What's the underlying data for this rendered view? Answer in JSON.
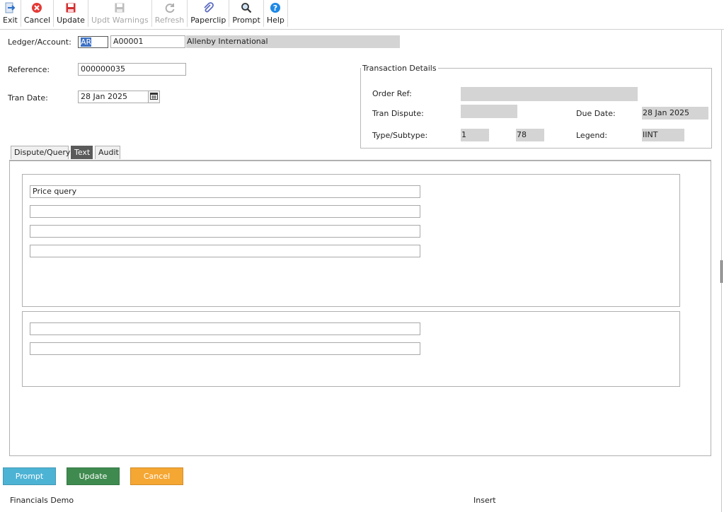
{
  "toolbar": {
    "exit": "Exit",
    "cancel": "Cancel",
    "update": "Update",
    "updt_warnings": "Updt Warnings",
    "refresh": "Refresh",
    "paperclip": "Paperclip",
    "prompt": "Prompt",
    "help": "Help"
  },
  "header": {
    "ledger_label": "Ledger/Account:",
    "ledger_value": "AR",
    "account_value": "A00001",
    "account_name": "Allenby International",
    "reference_label": "Reference:",
    "reference_value": "000000035",
    "tran_date_label": "Tran Date:",
    "tran_date_value": "28 Jan 2025"
  },
  "transaction_details": {
    "title": "Transaction Details",
    "order_ref_label": "Order Ref:",
    "order_ref_value": "",
    "tran_dispute_label": "Tran Dispute:",
    "tran_dispute_value": "",
    "due_date_label": "Due Date:",
    "due_date_value": "28 Jan 2025",
    "type_label": "Type/Subtype:",
    "type_value": "1",
    "subtype_value": "78",
    "legend_label": "Legend:",
    "legend_value": "IINT"
  },
  "tabs": [
    "Dispute/Query",
    "Text",
    "Audit"
  ],
  "active_tab": "Text",
  "text_lines_group1": [
    "Price query",
    "",
    "",
    ""
  ],
  "text_lines_group2": [
    "",
    ""
  ],
  "buttons": {
    "prompt": "Prompt",
    "update": "Update",
    "cancel": "Cancel"
  },
  "colors": {
    "prompt_button": "#4db3d4",
    "update_button": "#3f8b4f",
    "cancel_button": "#f5a733"
  },
  "status": {
    "left": "Financials Demo",
    "mode": "Insert"
  }
}
